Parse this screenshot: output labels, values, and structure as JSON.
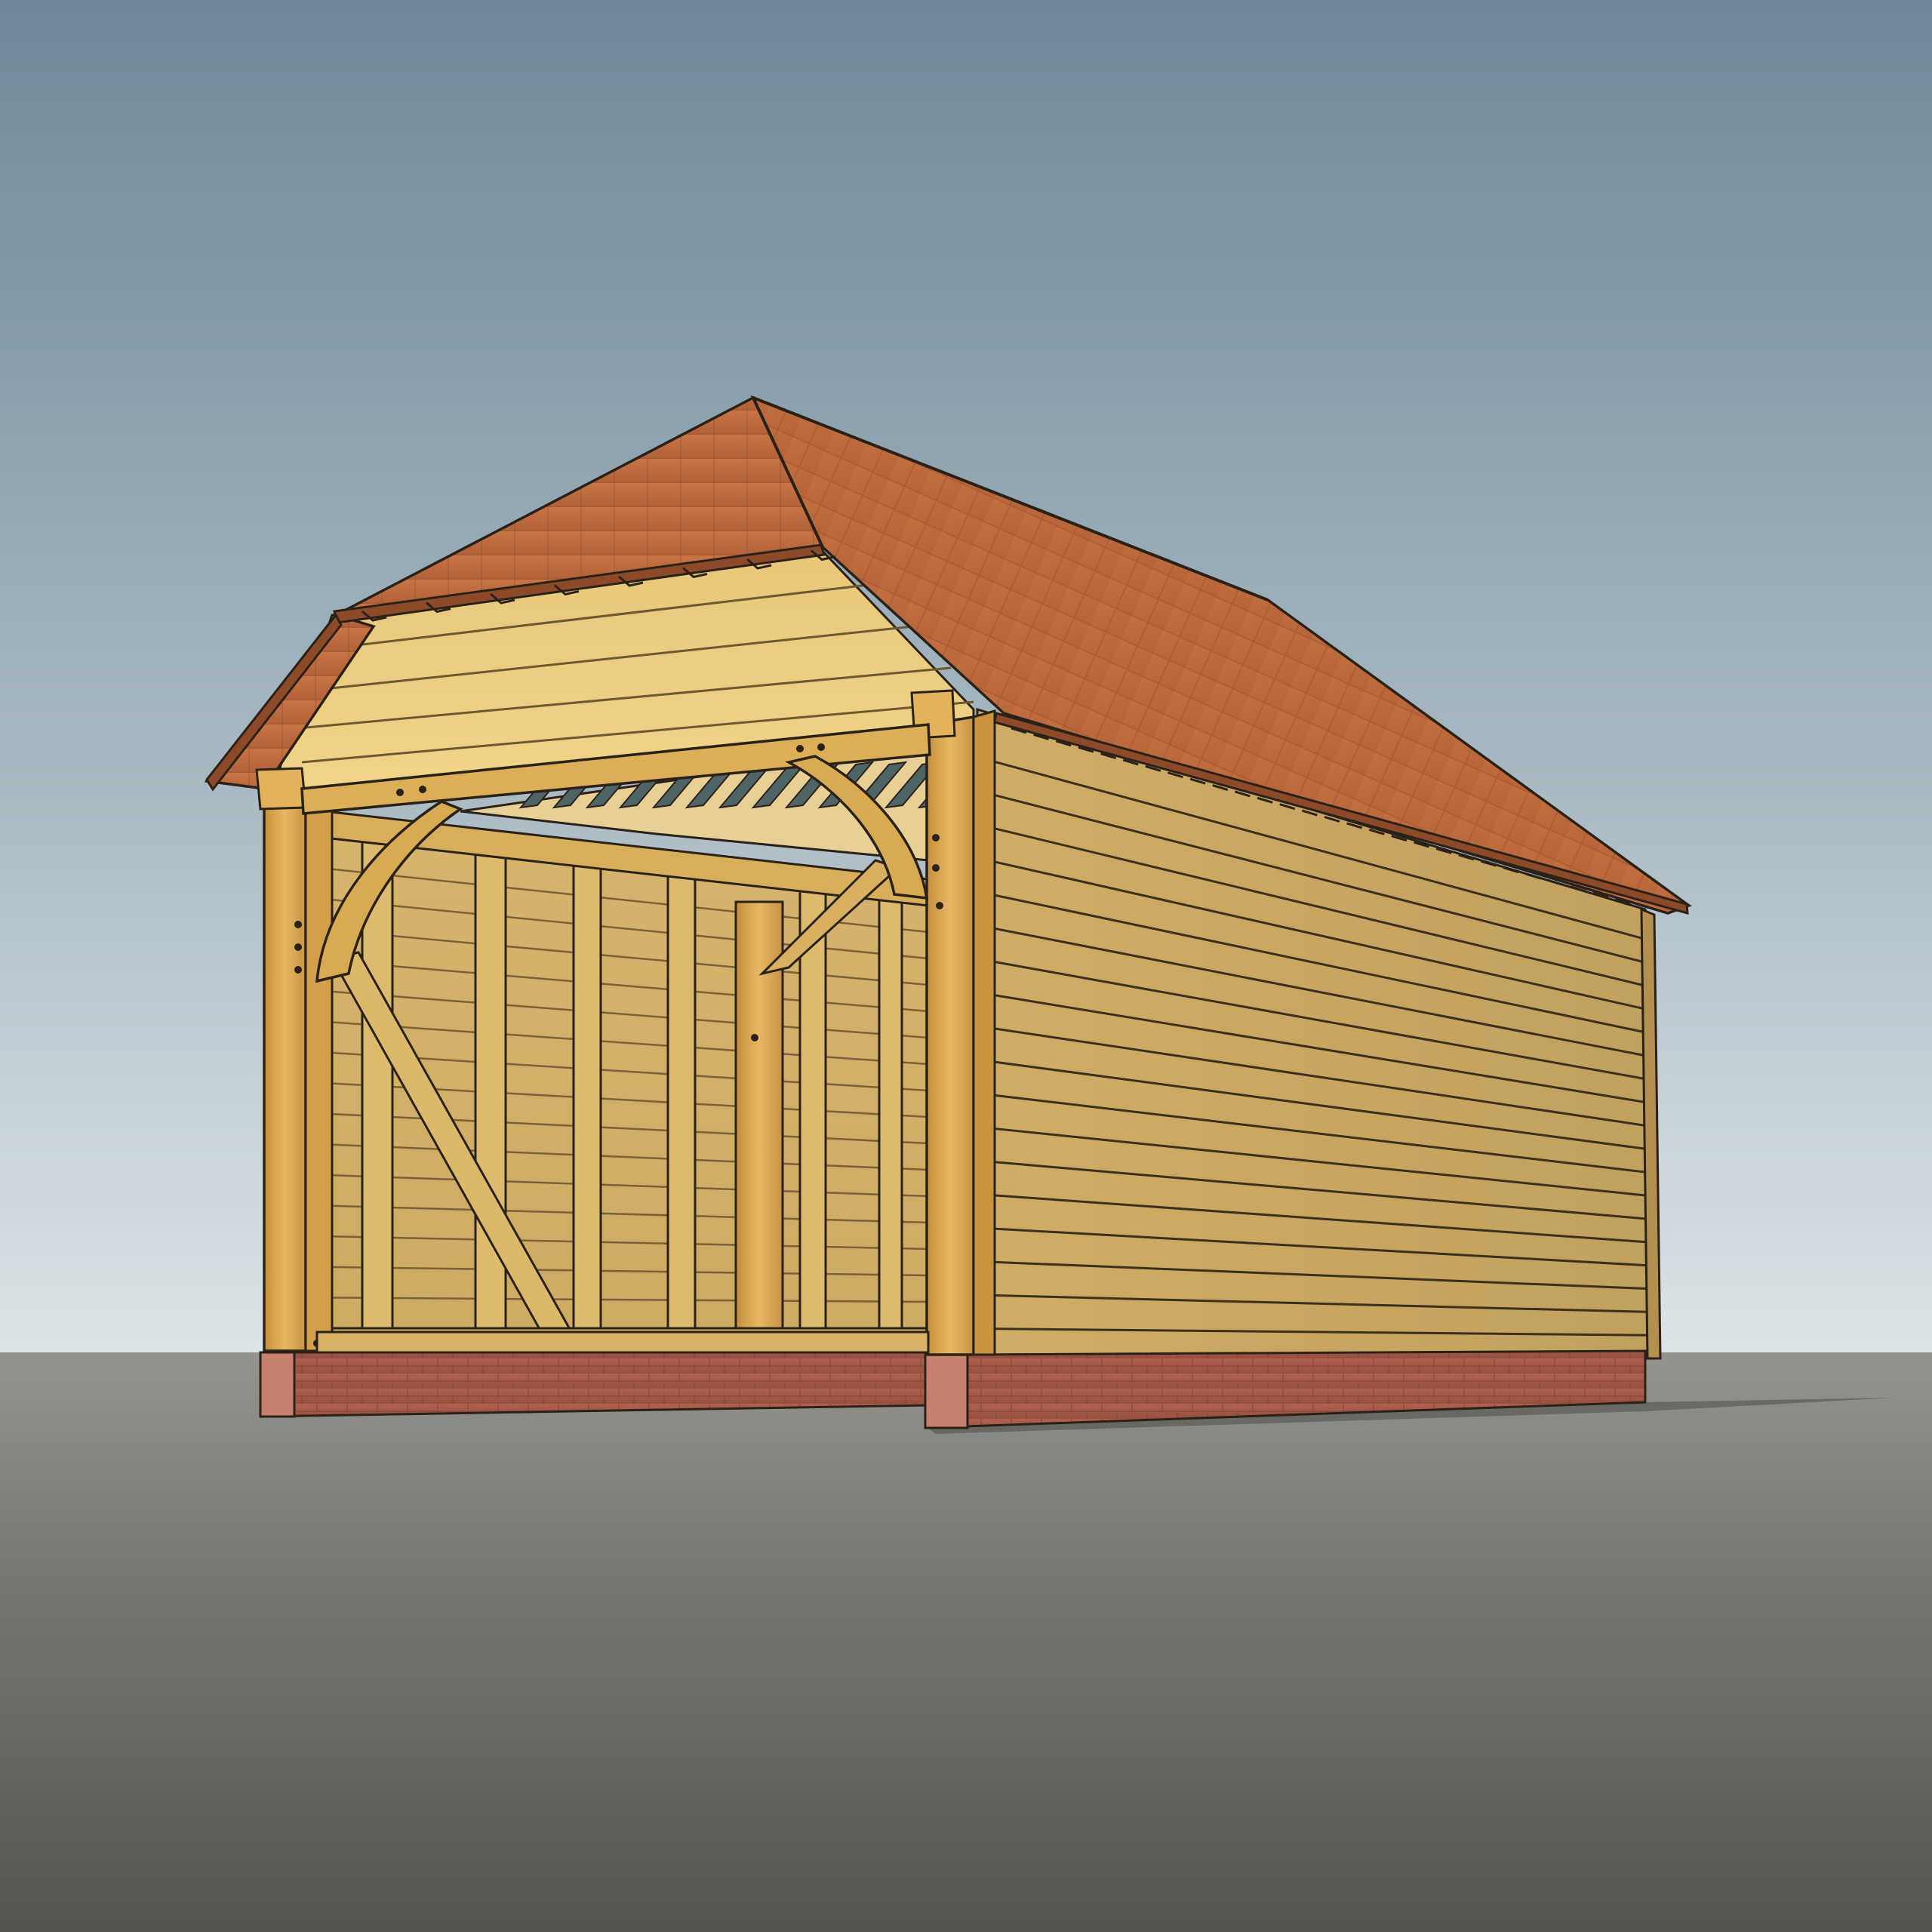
{
  "scene": {
    "subject": "oak-frame-single-bay-garage",
    "colors": {
      "sky_top": "#6f8797",
      "sky_mid": "#a6b7c1",
      "sky_bottom": "#dde4e7",
      "ground_top": "#8e8c87",
      "ground_bottom": "#555550",
      "roof_tile": "#b9683a",
      "roof_tile_dark": "#8f4a27",
      "oak_light": "#e3b967",
      "oak_mid": "#cf9c45",
      "oak_dark": "#a97a34",
      "cladding": "#c7a560",
      "brick": "#a8594a",
      "membrane": "#4f6565",
      "outline": "#2a2218"
    },
    "bay_count": 1,
    "side_frames": 2
  }
}
